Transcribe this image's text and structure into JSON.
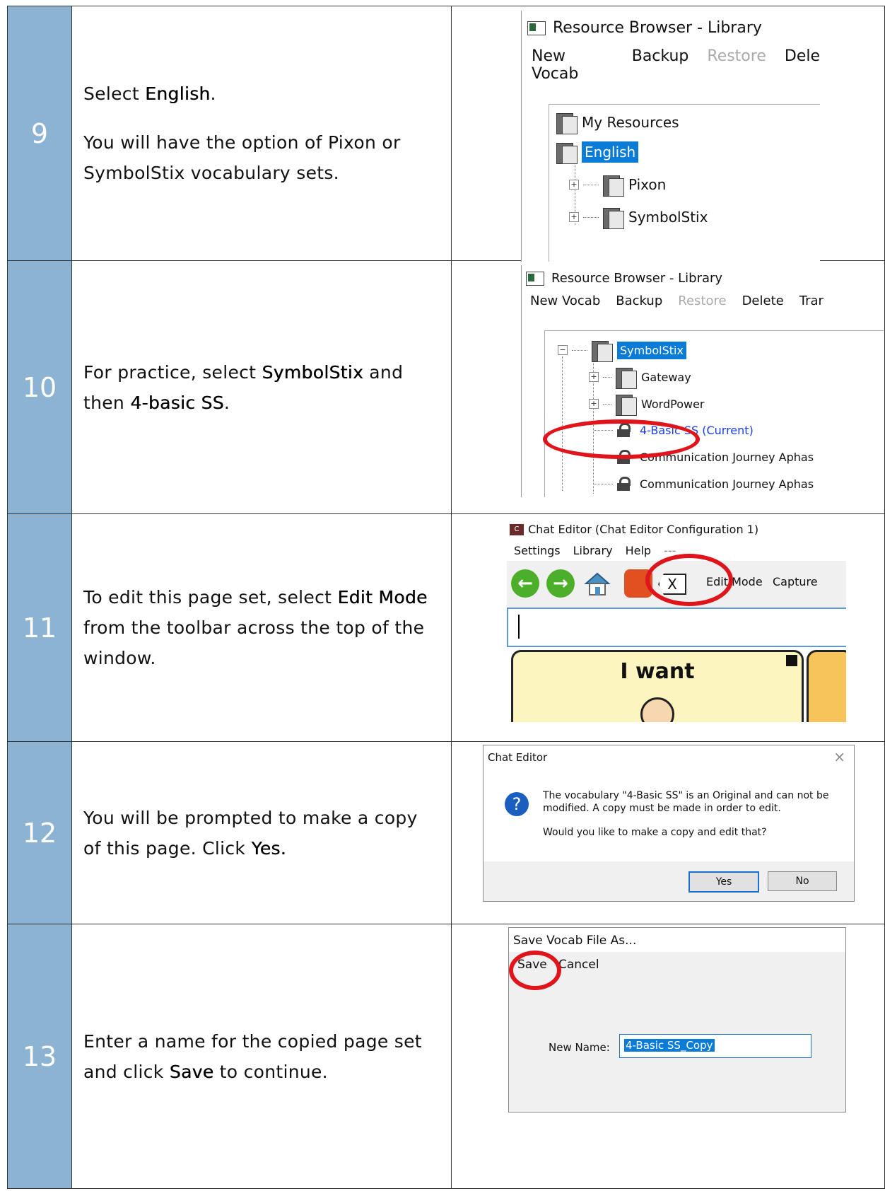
{
  "steps": [
    {
      "number": "9",
      "text_parts": [
        {
          "pre": "Select ",
          "bold": "English",
          "post": "."
        },
        {
          "pre": "You will have the option of Pixon or SymbolStix vocabulary sets.",
          "bold": "",
          "post": ""
        }
      ],
      "screenshot": {
        "title": "Resource Browser - Library",
        "menu": [
          "New Vocab",
          "Backup",
          "Restore",
          "Dele"
        ],
        "tree": [
          "My Resources",
          "English",
          "Pixon",
          "SymbolStix"
        ]
      }
    },
    {
      "number": "10",
      "text_parts": [
        {
          "pre": "For practice, select ",
          "bold": "SymbolStix",
          "post": " and then ",
          "bold2": "4-basic SS",
          "post2": "."
        }
      ],
      "screenshot": {
        "title": "Resource Browser - Library",
        "menu": [
          "New Vocab",
          "Backup",
          "Restore",
          "Delete",
          "Trar"
        ],
        "tree": [
          "SymbolStix",
          "Gateway",
          "WordPower",
          "4-Basic SS (Current)",
          "Communication Journey Aphas",
          "Communication Journey Aphas"
        ]
      }
    },
    {
      "number": "11",
      "text_parts": [
        {
          "pre": "To edit this page set, select ",
          "bold": "Edit Mode",
          "post": " from the toolbar across the top of the window."
        }
      ],
      "screenshot": {
        "title": "Chat Editor (Chat Editor Configuration 1)",
        "menu": [
          "Settings",
          "Library",
          "Help",
          "---"
        ],
        "toolbar": [
          "Edit Mode",
          "Capture"
        ],
        "button_label": "I want"
      }
    },
    {
      "number": "12",
      "text_parts": [
        {
          "pre": "You will be prompted to make a copy of this page. Click ",
          "bold": "Yes.",
          "post": ""
        }
      ],
      "screenshot": {
        "title": "Chat Editor",
        "message_line1": "The vocabulary \"4-Basic SS\" is an Original and can not be",
        "message_line2": "modified. A copy must be made in order to edit.",
        "question": "Would you like to make a copy and edit that?",
        "yes": "Yes",
        "no": "No"
      }
    },
    {
      "number": "13",
      "text_parts": [
        {
          "pre": "Enter a name for the copied page set and click ",
          "bold": "Save",
          "post": " to continue."
        }
      ],
      "screenshot": {
        "title": "Save Vocab File As...",
        "menu": [
          "Save",
          "Cancel"
        ],
        "field_label": "New Name:",
        "field_value": "4-Basic SS_Copy"
      }
    }
  ]
}
